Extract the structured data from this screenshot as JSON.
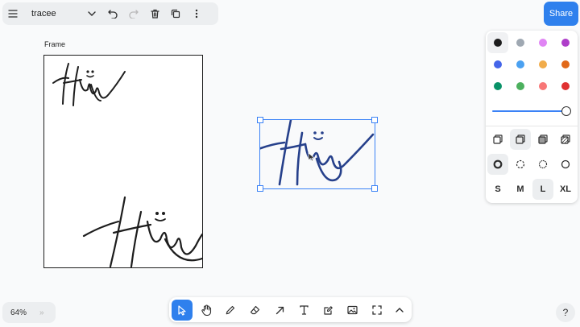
{
  "app": {
    "document_title": "tracee",
    "share_label": "Share",
    "help_label": "?"
  },
  "frame": {
    "label": "Frame"
  },
  "zoom": {
    "value": "64%",
    "minimap_toggle": "»"
  },
  "style_panel": {
    "colors": [
      {
        "name": "black",
        "hex": "#1d1d1d",
        "selected": true
      },
      {
        "name": "grey",
        "hex": "#9fa8b2"
      },
      {
        "name": "light-violet",
        "hex": "#e085f4"
      },
      {
        "name": "violet",
        "hex": "#ae3ec9"
      },
      {
        "name": "blue",
        "hex": "#4465e9"
      },
      {
        "name": "light-blue",
        "hex": "#4ba1f1"
      },
      {
        "name": "yellow",
        "hex": "#f1ac4b"
      },
      {
        "name": "orange",
        "hex": "#e16919"
      },
      {
        "name": "green",
        "hex": "#099268"
      },
      {
        "name": "light-green",
        "hex": "#4cb05e"
      },
      {
        "name": "light-red",
        "hex": "#f87777"
      },
      {
        "name": "red",
        "hex": "#e03131"
      }
    ],
    "opacity": 1.0,
    "fill_options": [
      "none",
      "semi",
      "solid",
      "pattern"
    ],
    "dash_options": [
      "draw",
      "dashed",
      "dotted",
      "solid"
    ],
    "size_options": [
      "S",
      "M",
      "L",
      "XL"
    ],
    "selected_size": "L"
  },
  "toolbar": {
    "tools": [
      "select",
      "hand",
      "draw",
      "eraser",
      "arrow",
      "text",
      "note",
      "media",
      "frame",
      "more"
    ],
    "active_tool": "select"
  },
  "accent": "#2f80ed"
}
